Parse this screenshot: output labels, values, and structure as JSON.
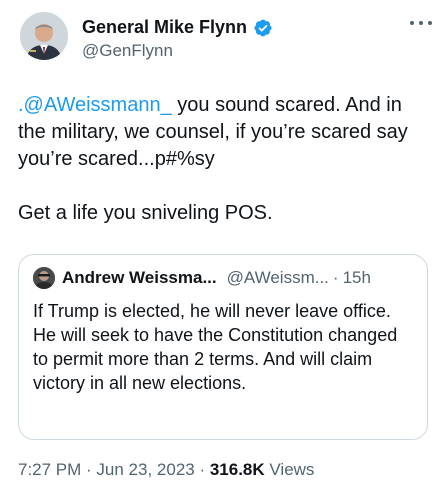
{
  "author": {
    "display_name": "General Mike Flynn",
    "handle": "@GenFlynn",
    "verified_color": "#1d9bf0"
  },
  "tweet": {
    "mention": ".@AWeissmann_",
    "line1_rest": " you sound scared. And in the military, we counsel, if you’re scared say you’re scared...p#%sy",
    "line2": "Get a life you sniveling POS."
  },
  "quote": {
    "display_name": "Andrew Weissma...",
    "handle": "@AWeissm...",
    "separator": "·",
    "time": "15h",
    "text": "If Trump is elected, he will never leave office. He will seek to have the Constitution changed to permit more than 2 terms. And will claim victory in all new elections."
  },
  "meta": {
    "time": "7:27 PM",
    "sep1": " · ",
    "date": "Jun 23, 2023",
    "sep2": " · ",
    "views_count": "316.8K",
    "views_label": " Views"
  },
  "icons": {
    "avatar": "profile-photo",
    "verified": "verified-badge-icon",
    "more": "more-options-icon",
    "quote_avatar": "quote-profile-photo"
  }
}
